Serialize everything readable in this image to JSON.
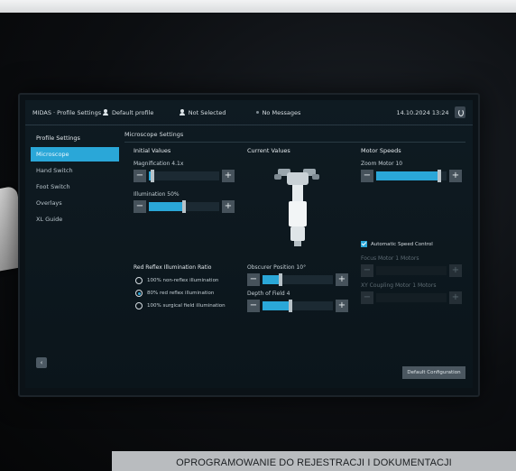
{
  "topbar": {
    "title": "MIDAS · Profile Settings",
    "profile_label": "Default profile",
    "user_label": "Not Selected",
    "messages_label": "No Messages",
    "datetime": "14.10.2024 13:24"
  },
  "sidebar": {
    "heading": "Profile Settings",
    "items": [
      {
        "label": "Microscope"
      },
      {
        "label": "Hand Switch"
      },
      {
        "label": "Foot Switch"
      },
      {
        "label": "Overlays"
      },
      {
        "label": "XL Guide"
      }
    ],
    "logout_symbol": "‹"
  },
  "main": {
    "heading": "Microscope Settings",
    "initial_values": {
      "title": "Initial Values",
      "magnification_label": "Magnification 4.1x",
      "magnification_level": 0.05,
      "illumination_label": "Illumination 50%",
      "illumination_level": 0.5
    },
    "current_values": {
      "title": "Current Values",
      "eyepiece_label": "Obscurer Position 10°",
      "eyepiece_level": 0.25,
      "depth_label": "Depth of Field 4",
      "depth_level": 0.4
    },
    "motor_speeds": {
      "title": "Motor Speeds",
      "zoom_label": "Zoom Motor 10",
      "zoom_level": 0.9,
      "auto_label": "Automatic Speed Control",
      "focus_label": "Focus Motor 1 Motors",
      "xy_label": "XY Coupling Motor 1 Motors"
    },
    "red_reflex": {
      "title": "Red Reflex Illumination Ratio",
      "options": [
        {
          "label": "100% non-reflex illumination",
          "selected": false
        },
        {
          "label": "80% red reflex illumination",
          "selected": true
        },
        {
          "label": "100% surgical field illumination",
          "selected": false
        }
      ]
    },
    "default_button": "Default Configuration"
  },
  "banner": {
    "text": "OPROGRAMOWANIE DO REJESTRACJI I DOKUMENTACJI"
  },
  "colors": {
    "accent": "#2aa7d8",
    "panel": "#0f1b22"
  }
}
